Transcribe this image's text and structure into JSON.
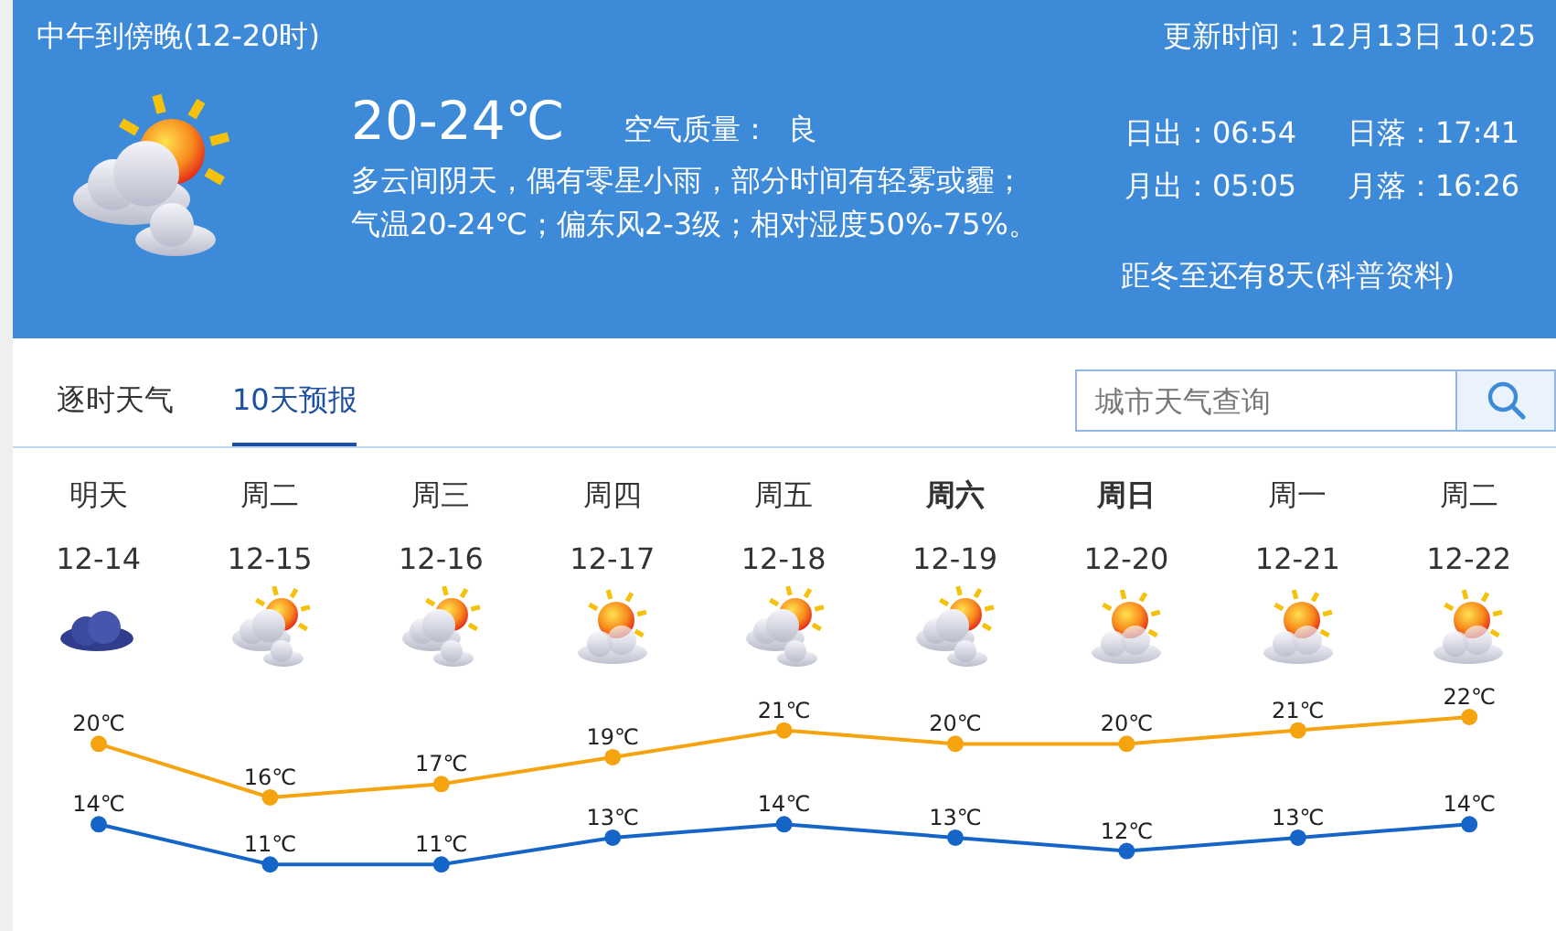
{
  "header": {
    "period": "中午到傍晚(12-20时)",
    "updated": "更新时间：12月13日 10:25",
    "kind": "sun-and-clouds",
    "temperature": "20-24℃",
    "air_quality_label": "空气质量：",
    "air_quality": "良",
    "description_lines": [
      "多云间阴天，偶有零星小雨，部分时间有轻雾或霾；",
      "气温20-24℃；偏东风2-3级；相对湿度50%-75%。"
    ],
    "astronomy": [
      "日出：06:54",
      "日落：17:41",
      "月出：05:05",
      "月落：16:26"
    ],
    "note_link": "距冬至还有8天(科普资料)"
  },
  "tabs": [
    {
      "label": "逐时天气",
      "selected": false
    },
    {
      "label": "10天预报",
      "selected": true
    }
  ],
  "search": {
    "placeholder": "城市天气查询"
  },
  "days": [
    {
      "weekday": "明天",
      "date": "12-14",
      "kind": "cloud",
      "weekend": false
    },
    {
      "weekday": "周二",
      "date": "12-15",
      "kind": "sun-and-clouds",
      "weekend": false
    },
    {
      "weekday": "周三",
      "date": "12-16",
      "kind": "sun-and-clouds",
      "weekend": false
    },
    {
      "weekday": "周四",
      "date": "12-17",
      "kind": "sun-cloud",
      "weekend": false
    },
    {
      "weekday": "周五",
      "date": "12-18",
      "kind": "sun-and-clouds",
      "weekend": false
    },
    {
      "weekday": "周六",
      "date": "12-19",
      "kind": "sun-and-clouds",
      "weekend": true
    },
    {
      "weekday": "周日",
      "date": "12-20",
      "kind": "sun-cloud",
      "weekend": true
    },
    {
      "weekday": "周一",
      "date": "12-21",
      "kind": "sun-cloud",
      "weekend": false
    },
    {
      "weekday": "周二",
      "date": "12-22",
      "kind": "sun-cloud",
      "weekend": false
    }
  ],
  "chart_data": {
    "type": "line",
    "data_labels": true,
    "series": [
      {
        "color": "#f5a30f",
        "marker": true,
        "values": [
          20,
          16,
          17,
          19,
          21,
          20,
          20,
          21,
          22
        ],
        "value_labels": [
          "20℃",
          "16℃",
          "17℃",
          "19℃",
          "21℃",
          "20℃",
          "20℃",
          "21℃",
          "22℃"
        ]
      },
      {
        "color": "#1565c8",
        "marker": true,
        "values": [
          14,
          11,
          11,
          13,
          14,
          13,
          12,
          13,
          14
        ],
        "value_labels": [
          "14℃",
          "11℃",
          "11℃",
          "13℃",
          "14℃",
          "13℃",
          "12℃",
          "13℃",
          "14℃"
        ]
      }
    ]
  }
}
